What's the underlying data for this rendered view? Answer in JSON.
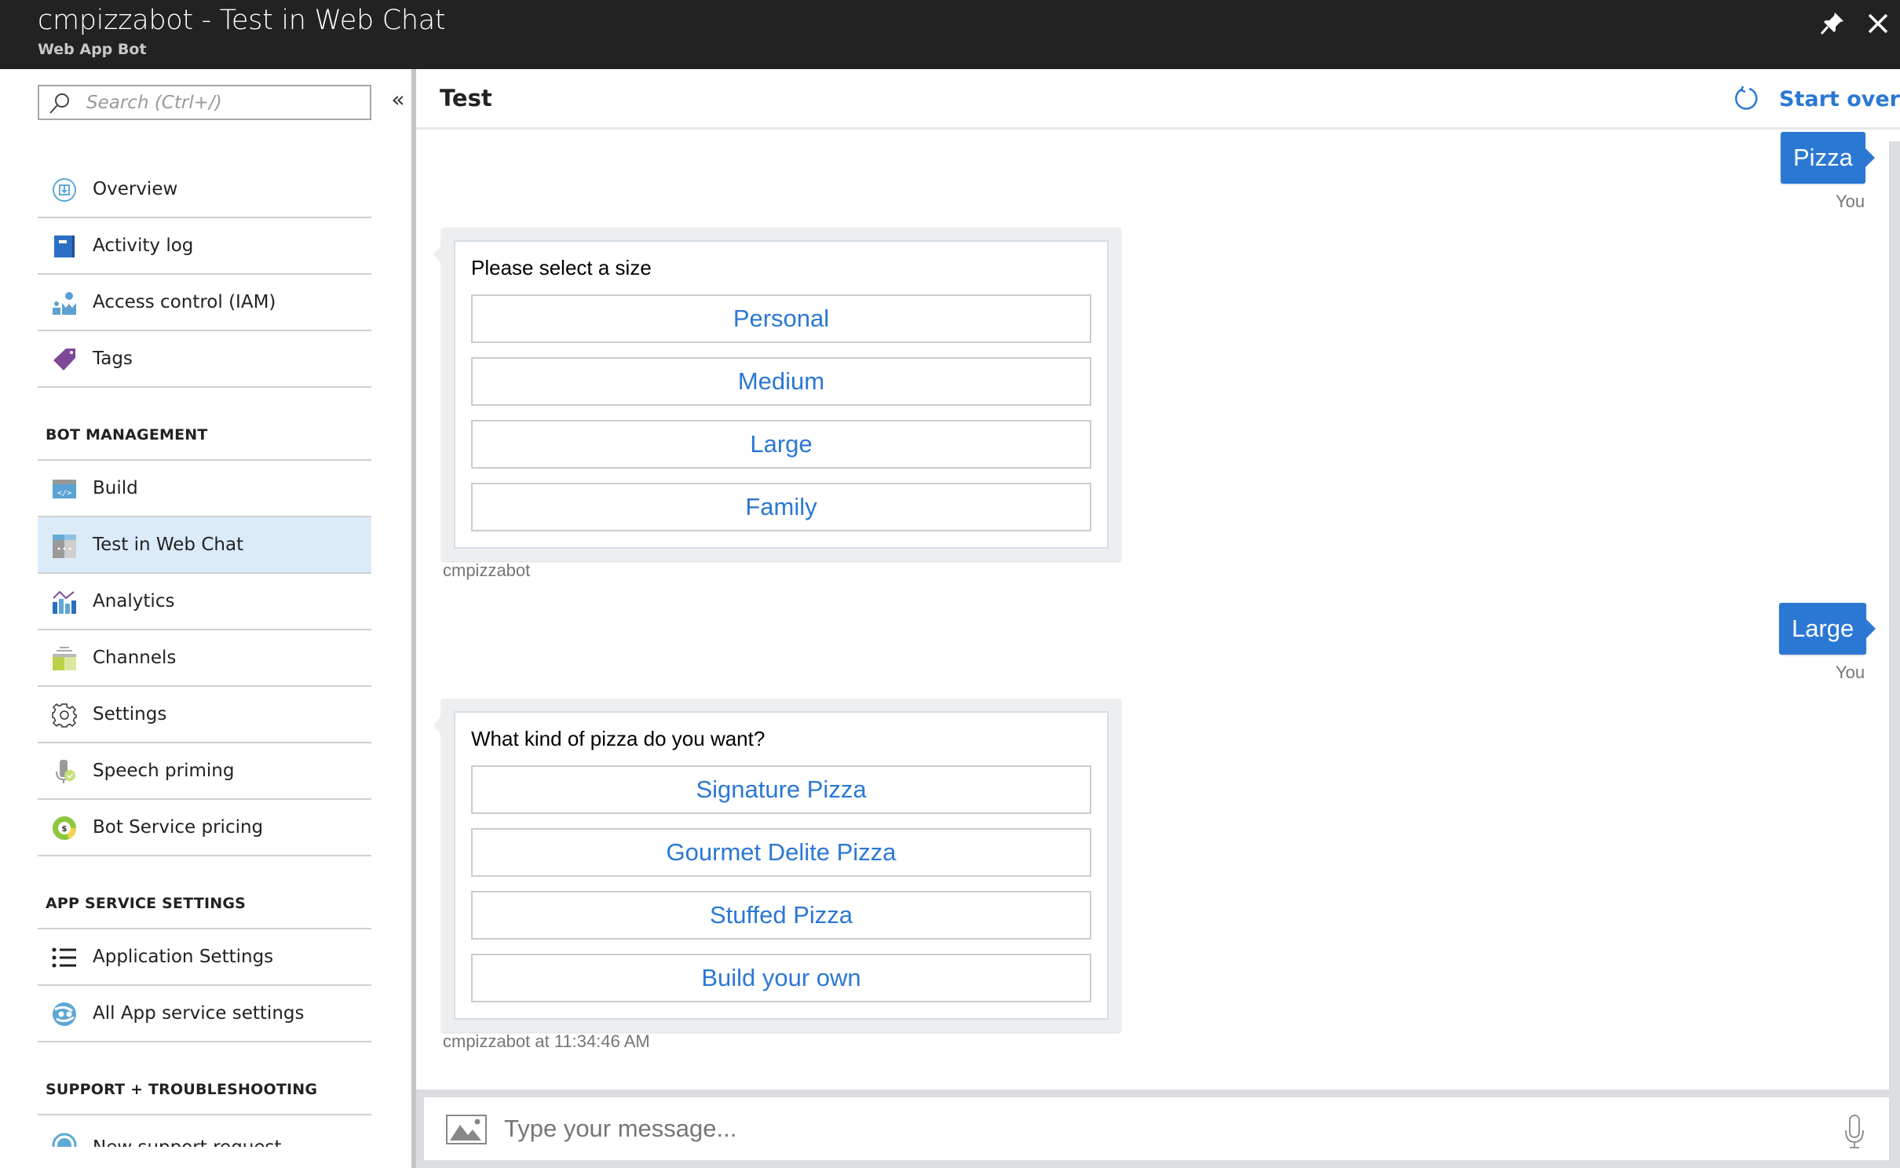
{
  "window": {
    "title": "cmpizzabot - Test in Web Chat",
    "subtitle": "Web App Bot",
    "pin_icon": "pin-icon",
    "close_icon": "close-icon"
  },
  "sidebar": {
    "search_placeholder": "Search (Ctrl+/)",
    "collapse_label": "«",
    "top_items": [
      {
        "label": "Overview",
        "icon": "overview-icon"
      },
      {
        "label": "Activity log",
        "icon": "activity-log-icon"
      },
      {
        "label": "Access control (IAM)",
        "icon": "access-control-icon"
      },
      {
        "label": "Tags",
        "icon": "tag-icon"
      }
    ],
    "sections": [
      {
        "title": "BOT MANAGEMENT",
        "items": [
          {
            "label": "Build",
            "icon": "build-code-icon"
          },
          {
            "label": "Test in Web Chat",
            "icon": "web-chat-icon",
            "active": true
          },
          {
            "label": "Analytics",
            "icon": "analytics-icon"
          },
          {
            "label": "Channels",
            "icon": "channels-icon"
          },
          {
            "label": "Settings",
            "icon": "gear-icon"
          },
          {
            "label": "Speech priming",
            "icon": "speech-priming-icon"
          },
          {
            "label": "Bot Service pricing",
            "icon": "pricing-icon"
          }
        ]
      },
      {
        "title": "APP SERVICE SETTINGS",
        "items": [
          {
            "label": "Application Settings",
            "icon": "list-icon"
          },
          {
            "label": "All App service settings",
            "icon": "app-service-icon"
          }
        ]
      },
      {
        "title": "SUPPORT + TROUBLESHOOTING",
        "items": [
          {
            "label": "New support request",
            "icon": "support-icon",
            "clipped": true
          }
        ]
      }
    ]
  },
  "main": {
    "title": "Test",
    "start_over_label": "Start over",
    "accent_color": "#2b78d4",
    "messages": [
      {
        "from": "user",
        "text": "Pizza",
        "meta": "You"
      },
      {
        "from": "bot",
        "prompt": "Please select a size",
        "options": [
          "Personal",
          "Medium",
          "Large",
          "Family"
        ],
        "meta": "cmpizzabot"
      },
      {
        "from": "user",
        "text": "Large",
        "meta": "You"
      },
      {
        "from": "bot",
        "prompt": "What kind of pizza do you want?",
        "options": [
          "Signature Pizza",
          "Gourmet Delite Pizza",
          "Stuffed Pizza",
          "Build your own"
        ],
        "meta": "cmpizzabot at 11:34:46 AM"
      }
    ],
    "input_placeholder": "Type your message...",
    "input_value": ""
  }
}
